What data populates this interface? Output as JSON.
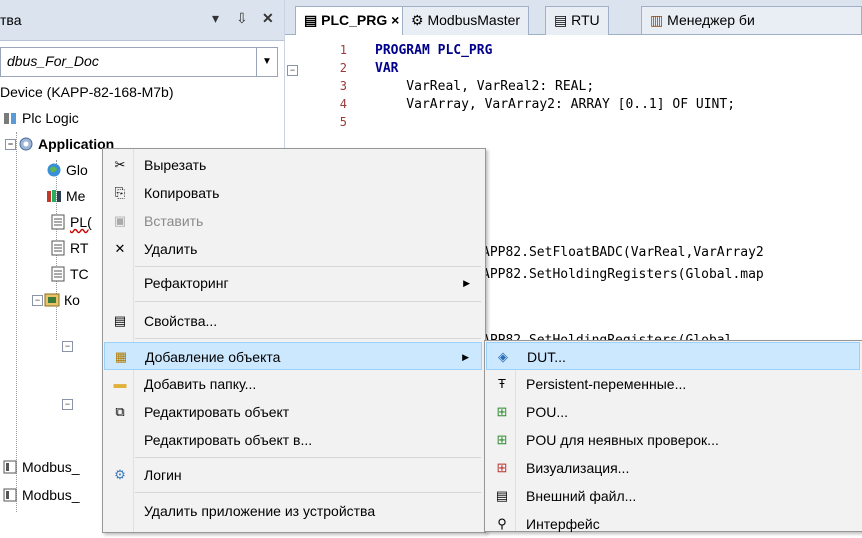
{
  "left_panel": {
    "title": "тва",
    "pin_symbol": "▾ ⇩ ✕",
    "device_combo_value": "dbus_For_Doc",
    "tree": [
      {
        "label": "Device (KAPP-82-168-M7b)",
        "icon": "device-icon"
      },
      {
        "label": "Plc Logic",
        "icon": "plc-logic-icon"
      },
      {
        "label": "Application",
        "icon": "application-icon"
      },
      {
        "label": "Glo",
        "icon": "globe-icon"
      },
      {
        "label": "Me",
        "icon": "library-icon"
      },
      {
        "label": "PL(",
        "icon": "doc-icon"
      },
      {
        "label": "RT",
        "icon": "doc-icon"
      },
      {
        "label": "TC",
        "icon": "doc-icon"
      },
      {
        "label": "Ко",
        "icon": "config-icon"
      },
      {
        "label": "Modbus_",
        "icon": "doc-icon"
      },
      {
        "label": "Modbus_",
        "icon": "doc-icon"
      }
    ]
  },
  "editor": {
    "tabs": [
      {
        "label": "PLC_PRG",
        "close": "×",
        "active": true
      },
      {
        "label": "ModbusMaster",
        "active": false
      },
      {
        "label": "RTU",
        "active": false
      },
      {
        "label": "Менеджер би",
        "active": false
      }
    ],
    "line_numbers": [
      "1",
      "2",
      "3",
      "4",
      "5"
    ],
    "code_lines": [
      "PROGRAM PLC_PRG",
      "VAR",
      "    VarReal, VarReal2: REAL;",
      "    VarArray, VarArray2: ARRAY [0..1] OF UINT;"
    ],
    "code_lower": [
      "APP82.SetFloatBADC(VarReal,VarArray2",
      "APP82.SetHoldingRegisters(Global.map",
      "APP82.SetHoldingRegisters(Global"
    ]
  },
  "context_menu": {
    "items": [
      {
        "label": "Вырезать",
        "icon": "scissors-icon",
        "glyph": "✂"
      },
      {
        "label": "Копировать",
        "icon": "copy-icon",
        "glyph": "⎘"
      },
      {
        "label": "Вставить",
        "icon": "paste-icon",
        "glyph": "📋",
        "disabled": true
      },
      {
        "label": "Удалить",
        "icon": "delete-icon",
        "glyph": "✕"
      },
      {
        "label": "Рефакторинг",
        "submenu": true
      },
      {
        "label": "Свойства...",
        "icon": "properties-icon",
        "glyph": "▤"
      },
      {
        "label": "Добавление объекта",
        "icon": "add-object-icon",
        "glyph": "▦",
        "submenu": true,
        "highlighted": true
      },
      {
        "label": "Добавить папку...",
        "icon": "folder-icon",
        "glyph": "▬"
      },
      {
        "label": "Редактировать объект",
        "icon": "edit-icon",
        "glyph": "⧉"
      },
      {
        "label": "Редактировать объект в...",
        "icon": "",
        "glyph": ""
      },
      {
        "label": "Логин",
        "icon": "login-icon",
        "glyph": "⚙"
      },
      {
        "label": "Удалить приложение из устройства",
        "icon": "",
        "glyph": ""
      }
    ]
  },
  "sub_menu": {
    "items": [
      {
        "label": "DUT...",
        "icon": "dut-icon",
        "glyph": "◈",
        "highlighted": true
      },
      {
        "label": "Persistent-переменные...",
        "icon": "persistent-icon",
        "glyph": "Ŧ"
      },
      {
        "label": "POU...",
        "icon": "pou-icon",
        "glyph": "⊞"
      },
      {
        "label": "POU для неявных проверок...",
        "icon": "pou-check-icon",
        "glyph": "⊞"
      },
      {
        "label": "Визуализация...",
        "icon": "visualization-icon",
        "glyph": "⊞"
      },
      {
        "label": "Внешний файл...",
        "icon": "external-file-icon",
        "glyph": "▤"
      },
      {
        "label": "Интерфейс",
        "icon": "interface-icon",
        "glyph": "⚲"
      }
    ]
  },
  "colors": {
    "menu_highlight": "#cce8ff",
    "keyword": "#00008b",
    "line_number": "#9a3b3b"
  }
}
